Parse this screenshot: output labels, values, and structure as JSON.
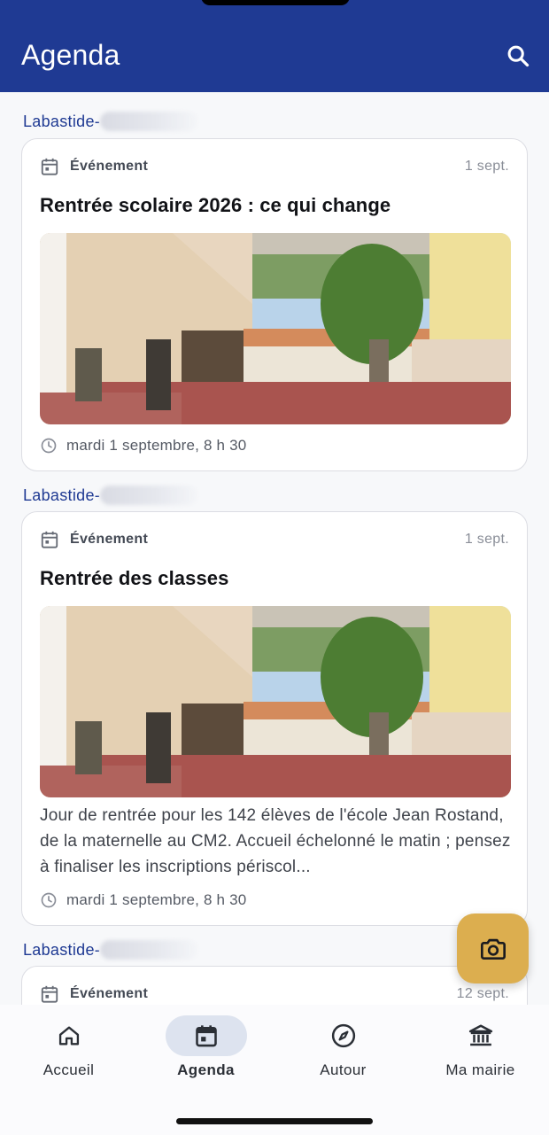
{
  "header": {
    "title": "Agenda"
  },
  "feed": [
    {
      "commune": "Labastide-",
      "type": "Événement",
      "date": "1 sept.",
      "title": "Rentrée scolaire 2026 : ce qui change",
      "description": "",
      "time": "mardi 1 septembre, 8 h 30"
    },
    {
      "commune": "Labastide-",
      "type": "Événement",
      "date": "1 sept.",
      "title": "Rentrée des classes",
      "description": "Jour de rentrée pour les 142 élèves de l'école Jean Rostand, de la maternelle au CM2. Accueil échelonné le matin ; pensez à finaliser les inscriptions périscol...",
      "time": "mardi 1 septembre, 8 h 30"
    },
    {
      "commune": "Labastide-",
      "type": "Événement",
      "date": "12 sept."
    }
  ],
  "nav": {
    "items": [
      {
        "label": "Accueil",
        "icon": "home-icon"
      },
      {
        "label": "Agenda",
        "icon": "calendar-icon",
        "active": true
      },
      {
        "label": "Autour",
        "icon": "compass-icon"
      },
      {
        "label": "Ma mairie",
        "icon": "town-hall-icon"
      }
    ]
  },
  "colors": {
    "header": "#1f3a93",
    "fab": "#dcae4f",
    "active_pill": "#dde3ef"
  }
}
